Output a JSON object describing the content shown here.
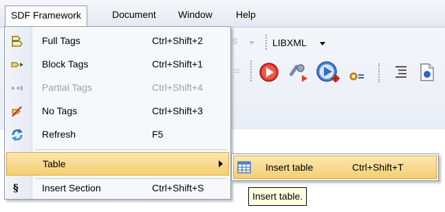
{
  "menubar": {
    "items": [
      "SDF Framework",
      "Document",
      "Window",
      "Help"
    ]
  },
  "toolbar": {
    "faded_text": "s",
    "xml_engine": "LIBXML",
    "icons": [
      "run-icon",
      "build-settings-icon",
      "debug-run-icon",
      "module-icon",
      "indent-icon",
      "document-icon"
    ]
  },
  "menu": {
    "items": [
      {
        "label": "Full Tags",
        "shortcut": "Ctrl+Shift+2",
        "icon": "full-tags-icon"
      },
      {
        "label": "Block Tags",
        "shortcut": "Ctrl+Shift+1",
        "icon": "block-tags-icon"
      },
      {
        "label": "Partial Tags",
        "shortcut": "Ctrl+Shift+4",
        "icon": "partial-tags-icon",
        "disabled": true
      },
      {
        "label": "No Tags",
        "shortcut": "Ctrl+Shift+3",
        "icon": "no-tags-icon"
      },
      {
        "label": "Refresh",
        "shortcut": "F5",
        "icon": "refresh-icon"
      },
      {
        "label": "Table",
        "shortcut": "",
        "icon": "",
        "highlighted": true,
        "has_submenu": true
      },
      {
        "label": "Insert Section",
        "shortcut": "Ctrl+Shift+S",
        "icon": "section-icon",
        "glyph": "§"
      }
    ]
  },
  "submenu": {
    "items": [
      {
        "label": "Insert table",
        "shortcut": "Ctrl+Shift+T",
        "icon": "table-icon"
      }
    ]
  },
  "tooltip": {
    "text": "Insert table."
  },
  "colors": {
    "highlight_top": "#fbe7b0",
    "highlight_bottom": "#f5cf72",
    "highlight_border": "#d9a63e",
    "menu_border": "#8e9aae",
    "tooltip_bg": "#ffffe1"
  }
}
